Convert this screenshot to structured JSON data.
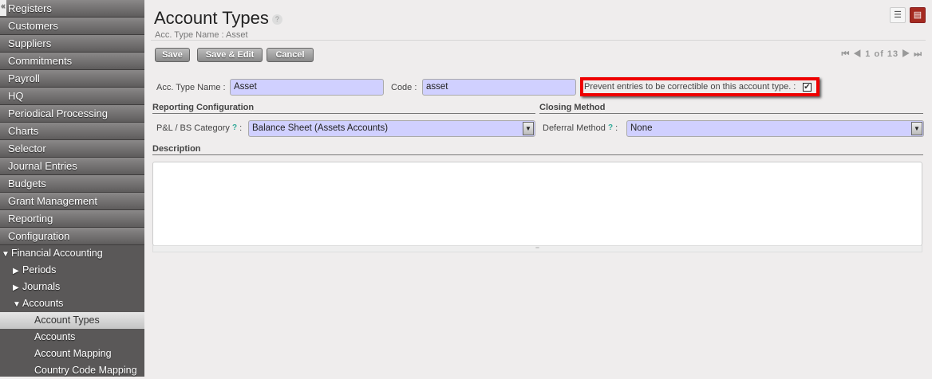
{
  "sidebar": {
    "collapse": "«",
    "menus": [
      "Registers",
      "Customers",
      "Suppliers",
      "Commitments",
      "Payroll",
      "HQ",
      "Periodical Processing",
      "Charts",
      "Selector",
      "Journal Entries",
      "Budgets",
      "Grant Management",
      "Reporting",
      "Configuration"
    ],
    "tree": {
      "root": "Financial Accounting",
      "periods": "Periods",
      "journals": "Journals",
      "accounts": "Accounts",
      "account_types": "Account Types",
      "accounts_item": "Accounts",
      "account_mapping": "Account Mapping",
      "country_code_mapping": "Country Code Mapping"
    }
  },
  "header": {
    "title": "Account Types",
    "help": "?",
    "subtitle": "Acc. Type Name : Asset"
  },
  "toolbar": {
    "save": "Save",
    "save_edit": "Save & Edit",
    "cancel": "Cancel",
    "pager": "1 of 13"
  },
  "form": {
    "acc_type_name_label": "Acc. Type Name :",
    "acc_type_name_value": "Asset",
    "code_label": "Code :",
    "code_value": "asset",
    "prevent_label": "Prevent entries to be correctible on this account type. :",
    "prevent_checked": true,
    "reporting_section": "Reporting Configuration",
    "closing_section": "Closing Method",
    "pl_label": "P&L / BS Category",
    "pl_value": "Balance Sheet (Assets Accounts)",
    "deferral_label": "Deferral Method",
    "deferral_value": "None",
    "q": "?",
    "colon": ":",
    "description_section": "Description",
    "description_value": ""
  },
  "colors": {
    "highlight": "#e00000",
    "input_bg": "#d0d0ff"
  }
}
